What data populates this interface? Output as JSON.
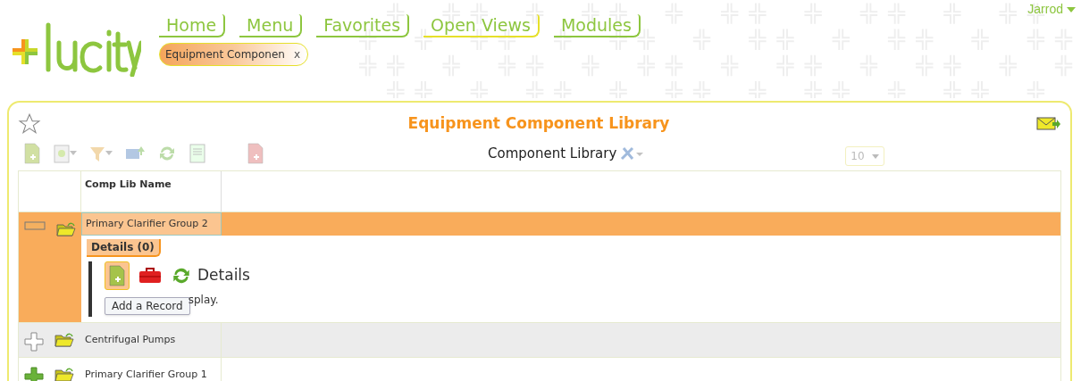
{
  "user": {
    "name": "Jarrod"
  },
  "nav": [
    {
      "label": "Home",
      "selected": false
    },
    {
      "label": "Menu",
      "selected": false
    },
    {
      "label": "Favorites",
      "selected": false
    },
    {
      "label": "Open Views",
      "selected": true
    },
    {
      "label": "Modules",
      "selected": false
    }
  ],
  "open_tabs": [
    {
      "label": "Equipment Componen",
      "close": "x"
    }
  ],
  "panel": {
    "title": "Equipment Component Library",
    "view_name": "Component Library",
    "page_size": "10"
  },
  "table": {
    "columns": [
      "Comp Lib Name"
    ],
    "rows": [
      {
        "name": "Primary Clarifier Group 2",
        "expanded": true,
        "hovered": false,
        "detail": {
          "tab": "Details (0)",
          "heading": "Details",
          "empty_text": "splay.",
          "tooltip": "Add a Record"
        }
      },
      {
        "name": "Centrifugal Pumps",
        "expanded": false,
        "hovered": true
      },
      {
        "name": "Primary Clarifier Group 1",
        "expanded": false,
        "hovered": false
      }
    ]
  }
}
